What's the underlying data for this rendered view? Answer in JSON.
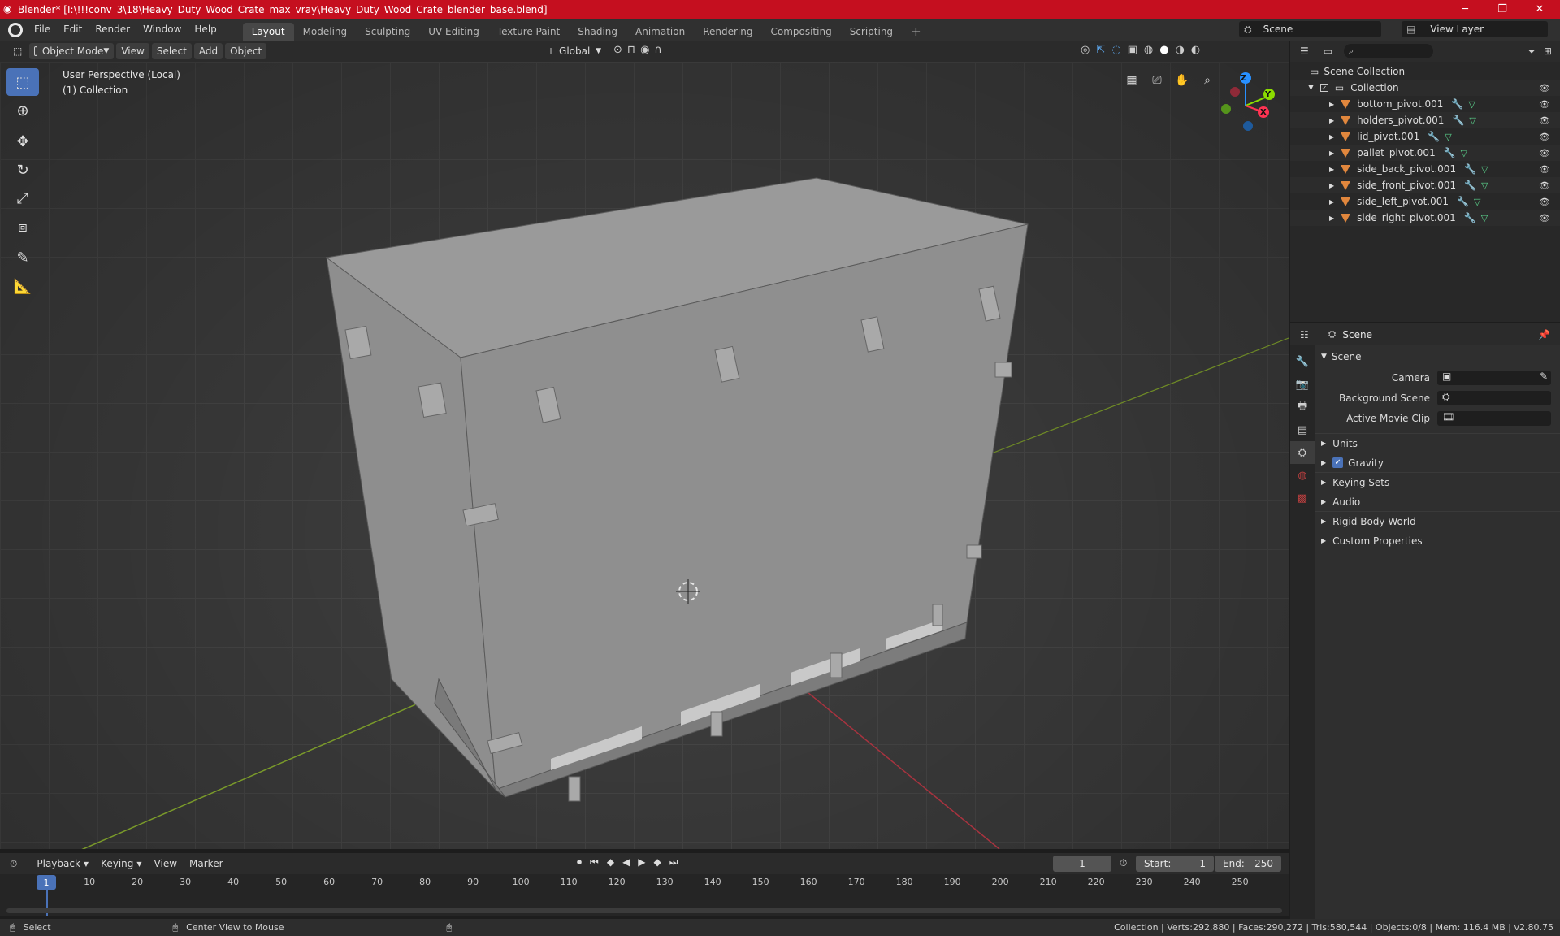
{
  "window": {
    "title": "Blender* [I:\\!!!conv_3\\18\\Heavy_Duty_Wood_Crate_max_vray\\Heavy_Duty_Wood_Crate_blender_base.blend]",
    "minimize": "─",
    "maximize": "❐",
    "close": "✕"
  },
  "menu": [
    "File",
    "Edit",
    "Render",
    "Window",
    "Help"
  ],
  "workspaces": [
    "Layout",
    "Modeling",
    "Sculpting",
    "UV Editing",
    "Texture Paint",
    "Shading",
    "Animation",
    "Rendering",
    "Compositing",
    "Scripting"
  ],
  "workspace_add": "+",
  "scene_selector": "Scene",
  "view_layer_selector": "View Layer",
  "viewport_header": {
    "mode": "Object Mode",
    "menus": [
      "View",
      "Select",
      "Add",
      "Object"
    ],
    "orientation": "Global"
  },
  "viewport": {
    "perspective": "User Perspective (Local)",
    "collection": "(1) Collection",
    "gizmo": {
      "z": "Z",
      "y": "Y",
      "x": "X"
    }
  },
  "outliner": {
    "root": "Scene Collection",
    "collection": "Collection",
    "items": [
      "bottom_pivot.001",
      "holders_pivot.001",
      "lid_pivot.001",
      "pallet_pivot.001",
      "side_back_pivot.001",
      "side_front_pivot.001",
      "side_left_pivot.001",
      "side_right_pivot.001"
    ]
  },
  "properties": {
    "context": "Scene",
    "panel": "Scene",
    "fields": [
      {
        "label": "Camera"
      },
      {
        "label": "Background Scene"
      },
      {
        "label": "Active Movie Clip"
      }
    ],
    "sections": [
      "Units",
      "Gravity",
      "Keying Sets",
      "Audio",
      "Rigid Body World",
      "Custom Properties"
    ],
    "gravity_checked": true
  },
  "timeline": {
    "menus": [
      "Playback",
      "Keying",
      "View",
      "Marker"
    ],
    "current_frame": "1",
    "start_label": "Start:",
    "start": "1",
    "end_label": "End:",
    "end": "250",
    "frame_marker": "1",
    "ticks": [
      "10",
      "20",
      "30",
      "40",
      "50",
      "60",
      "70",
      "80",
      "90",
      "100",
      "110",
      "120",
      "130",
      "140",
      "150",
      "160",
      "170",
      "180",
      "190",
      "200",
      "210",
      "220",
      "230",
      "240",
      "250"
    ]
  },
  "status": {
    "left_action": "Select",
    "mid_action": "Center View to Mouse",
    "stats": "Collection | Verts:292,880 | Faces:290,272 | Tris:580,544 | Objects:0/8 | Mem: 116.4 MB | v2.80.75"
  },
  "colors": {
    "titlebar": "#c50f1f",
    "active_tool": "#4a72b8",
    "mesh_icon": "#e1873d",
    "modifier_icon": "#5a9fe0",
    "data_icon": "#5cd68e",
    "axis_x": "#ff3352",
    "axis_y": "#8bdc00",
    "axis_z": "#2890ff"
  }
}
